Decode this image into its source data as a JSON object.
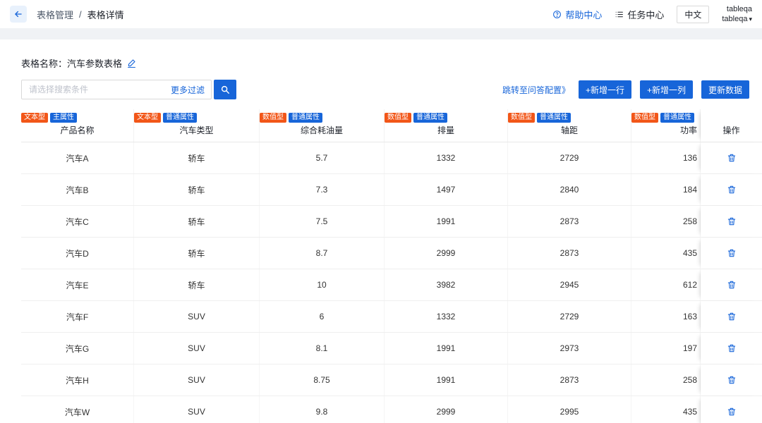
{
  "topbar": {
    "breadcrumb_parent": "表格管理",
    "breadcrumb_sep": "/",
    "breadcrumb_current": "表格详情",
    "help_center": "帮助中心",
    "task_center": "任务中心",
    "language": "中文",
    "org_name": "tableqa",
    "user_name": "tableqa"
  },
  "page": {
    "table_name_label": "表格名称：",
    "table_name": "汽车参数表格"
  },
  "toolbar": {
    "search_placeholder": "请选择搜索条件",
    "more_filter_label": "更多过滤",
    "jump_config_label": "跳转至问答配置》",
    "add_row_label": "+新增一行",
    "add_col_label": "+新增一列",
    "update_label": "更新数据"
  },
  "table": {
    "columns": [
      {
        "name": "产品名称",
        "type_tag": "文本型",
        "attr_tag": "主属性"
      },
      {
        "name": "汽车类型",
        "type_tag": "文本型",
        "attr_tag": "普通属性"
      },
      {
        "name": "综合耗油量",
        "type_tag": "数值型",
        "attr_tag": "普通属性"
      },
      {
        "name": "排量",
        "type_tag": "数值型",
        "attr_tag": "普通属性"
      },
      {
        "name": "轴距",
        "type_tag": "数值型",
        "attr_tag": "普通属性"
      },
      {
        "name": "功率",
        "type_tag": "数值型",
        "attr_tag": "普通属性"
      },
      {
        "name": "操作"
      }
    ],
    "rows": [
      [
        "汽车A",
        "轿车",
        "5.7",
        "1332",
        "2729",
        "136"
      ],
      [
        "汽车B",
        "轿车",
        "7.3",
        "1497",
        "2840",
        "184"
      ],
      [
        "汽车C",
        "轿车",
        "7.5",
        "1991",
        "2873",
        "258"
      ],
      [
        "汽车D",
        "轿车",
        "8.7",
        "2999",
        "2873",
        "435"
      ],
      [
        "汽车E",
        "轿车",
        "10",
        "3982",
        "2945",
        "612"
      ],
      [
        "汽车F",
        "SUV",
        "6",
        "1332",
        "2729",
        "163"
      ],
      [
        "汽车G",
        "SUV",
        "8.1",
        "1991",
        "2973",
        "197"
      ],
      [
        "汽车H",
        "SUV",
        "8.75",
        "1991",
        "2873",
        "258"
      ],
      [
        "汽车W",
        "SUV",
        "9.8",
        "2999",
        "2995",
        "435"
      ]
    ]
  },
  "colors": {
    "accent_blue": "#1765d9",
    "tag_orange": "#f25618",
    "tag_blue": "#1765d9"
  },
  "icons": {
    "back": "arrow-left",
    "help": "question-circle",
    "tasks": "task-list",
    "user_caret": "caret-down",
    "edit": "pencil",
    "search": "magnifier",
    "row_action": "trash"
  }
}
